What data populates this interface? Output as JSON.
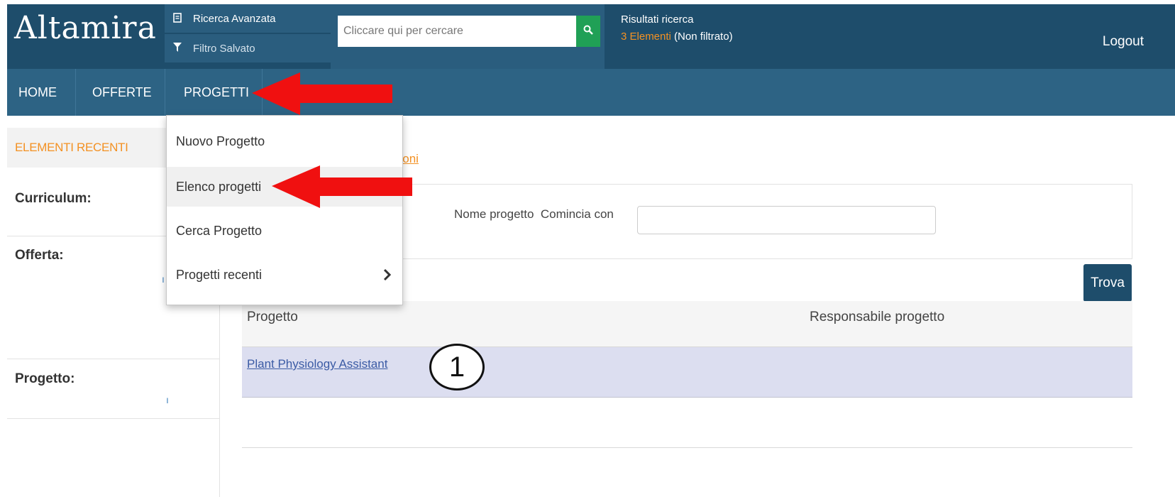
{
  "app": {
    "logo": "Altamira"
  },
  "header": {
    "advanced_search": "Ricerca Avanzata",
    "saved_filter": "Filtro Salvato",
    "search_placeholder": "Cliccare qui per cercare",
    "results_title": "Risultati ricerca",
    "results_count": "3 Elementi",
    "results_filter": " (Non filtrato)",
    "logout": "Logout"
  },
  "nav": {
    "items": [
      {
        "label": "HOME"
      },
      {
        "label": "OFFERTE"
      },
      {
        "label": "PROGETTI"
      }
    ]
  },
  "dropdown": {
    "items": [
      {
        "label": "Nuovo Progetto"
      },
      {
        "label": "Elenco progetti"
      },
      {
        "label": "Cerca Progetto"
      },
      {
        "label": "Progetti recenti"
      }
    ]
  },
  "sidebar": {
    "header": "ELEMENTI RECENTI",
    "sections": [
      {
        "label": "Curriculum:"
      },
      {
        "label": "Offerta:"
      },
      {
        "label": "Progetto:"
      }
    ]
  },
  "content": {
    "breadcrumb_fragment": "zioni",
    "filter_label": "Nome progetto  Comincia con",
    "find_button": "Trova",
    "table": {
      "headers": [
        "Progetto",
        "Responsabile progetto"
      ],
      "rows": [
        {
          "project": "Plant Physiology Assistant",
          "manager": ""
        }
      ]
    }
  },
  "annotations": {
    "step_number": "1",
    "arrow_color": "#f01010"
  },
  "colors": {
    "header_bg": "#1e4d6b",
    "nav_bg": "#2d6384",
    "accent_orange": "#f39123",
    "search_button": "#20a056",
    "selected_row": "#dcdef0"
  }
}
